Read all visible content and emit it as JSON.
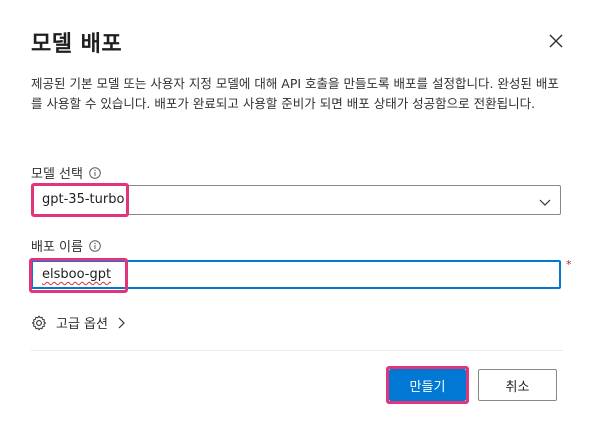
{
  "dialog": {
    "title": "모델 배포",
    "description": "제공된 기본 모델 또는 사용자 지정 모델에 대해 API 호출을 만들도록 배포를 설정합니다. 완성된 배포를 사용할 수 있습니다. 배포가 완료되고 사용할 준비가 되면 배포 상태가 성공함으로 전환됩니다."
  },
  "model_select": {
    "label": "모델 선택",
    "value": "gpt-35-turbo"
  },
  "deployment_name": {
    "label": "배포 이름",
    "value": "elsboo-gpt",
    "required_mark": "*"
  },
  "advanced": {
    "label": "고급 옵션"
  },
  "buttons": {
    "create": "만들기",
    "cancel": "취소"
  },
  "colors": {
    "primary": "#0078d4",
    "highlight": "#e0357b",
    "required": "#a4262c"
  }
}
